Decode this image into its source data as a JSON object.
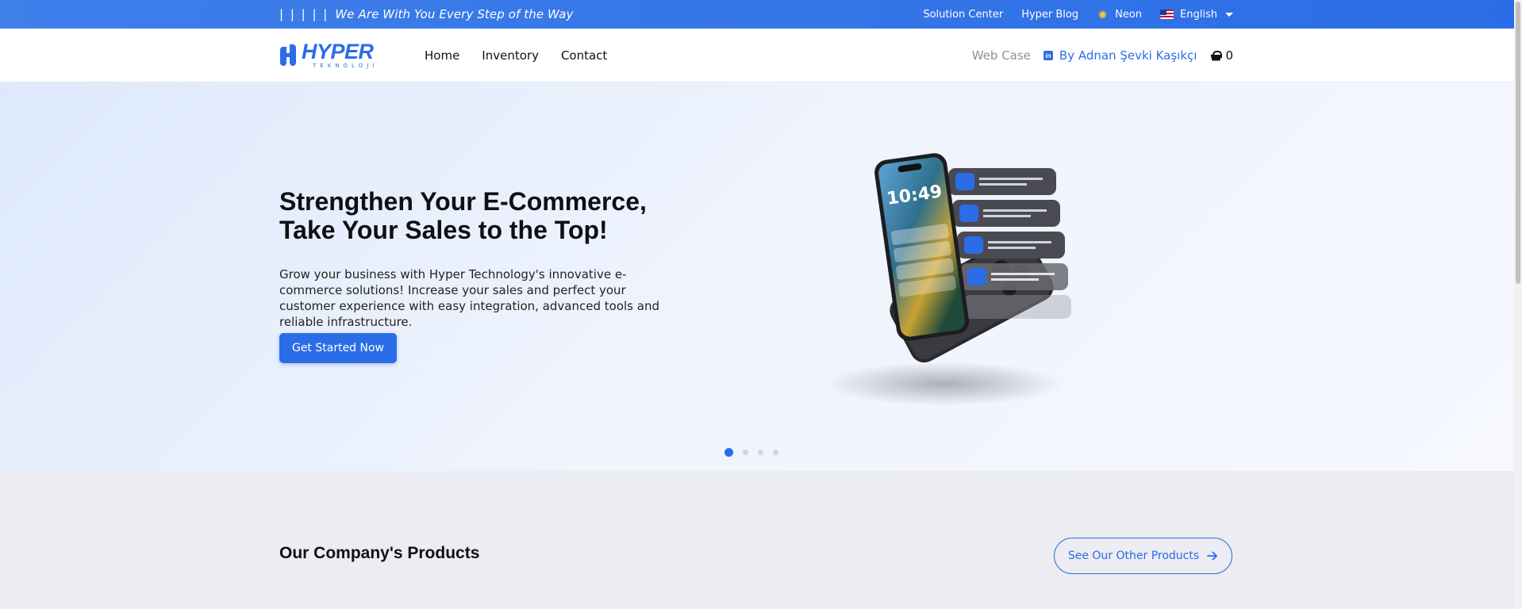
{
  "topbar": {
    "tagline_bars": "| | | | |",
    "tagline": "We Are With You Every Step of the Way",
    "links": {
      "solution_center": "Solution Center",
      "blog": "Hyper Blog",
      "theme": "Neon",
      "language": "English"
    }
  },
  "navbar": {
    "logo": {
      "main": "HYPER",
      "sub": "TEKNOLOJİ"
    },
    "links": [
      "Home",
      "Inventory",
      "Contact"
    ],
    "web_case": "Web Case",
    "author": "By Adnan Şevki Kaşıkçı",
    "cart_count": "0"
  },
  "hero": {
    "title_line1": "Strengthen Your E-Commerce,",
    "title_line2": "Take Your Sales to the Top!",
    "description": "Grow your business with Hyper Technology's innovative e-commerce solutions! Increase your sales and perfect your customer experience with easy integration, advanced tools and reliable infrastructure.",
    "cta": "Get Started Now",
    "phone_time": "10:49",
    "slides_total": 4,
    "active_slide": 1
  },
  "products": {
    "title": "Our Company's Products",
    "more_button": "See Our Other Products"
  },
  "colors": {
    "brand": "#2b6de6",
    "topbar": "#3f7fea"
  },
  "icons": [
    "sun-icon",
    "us-flag-icon",
    "chevron-down-icon",
    "linkedin-icon",
    "basket-icon",
    "arrow-right-icon"
  ]
}
